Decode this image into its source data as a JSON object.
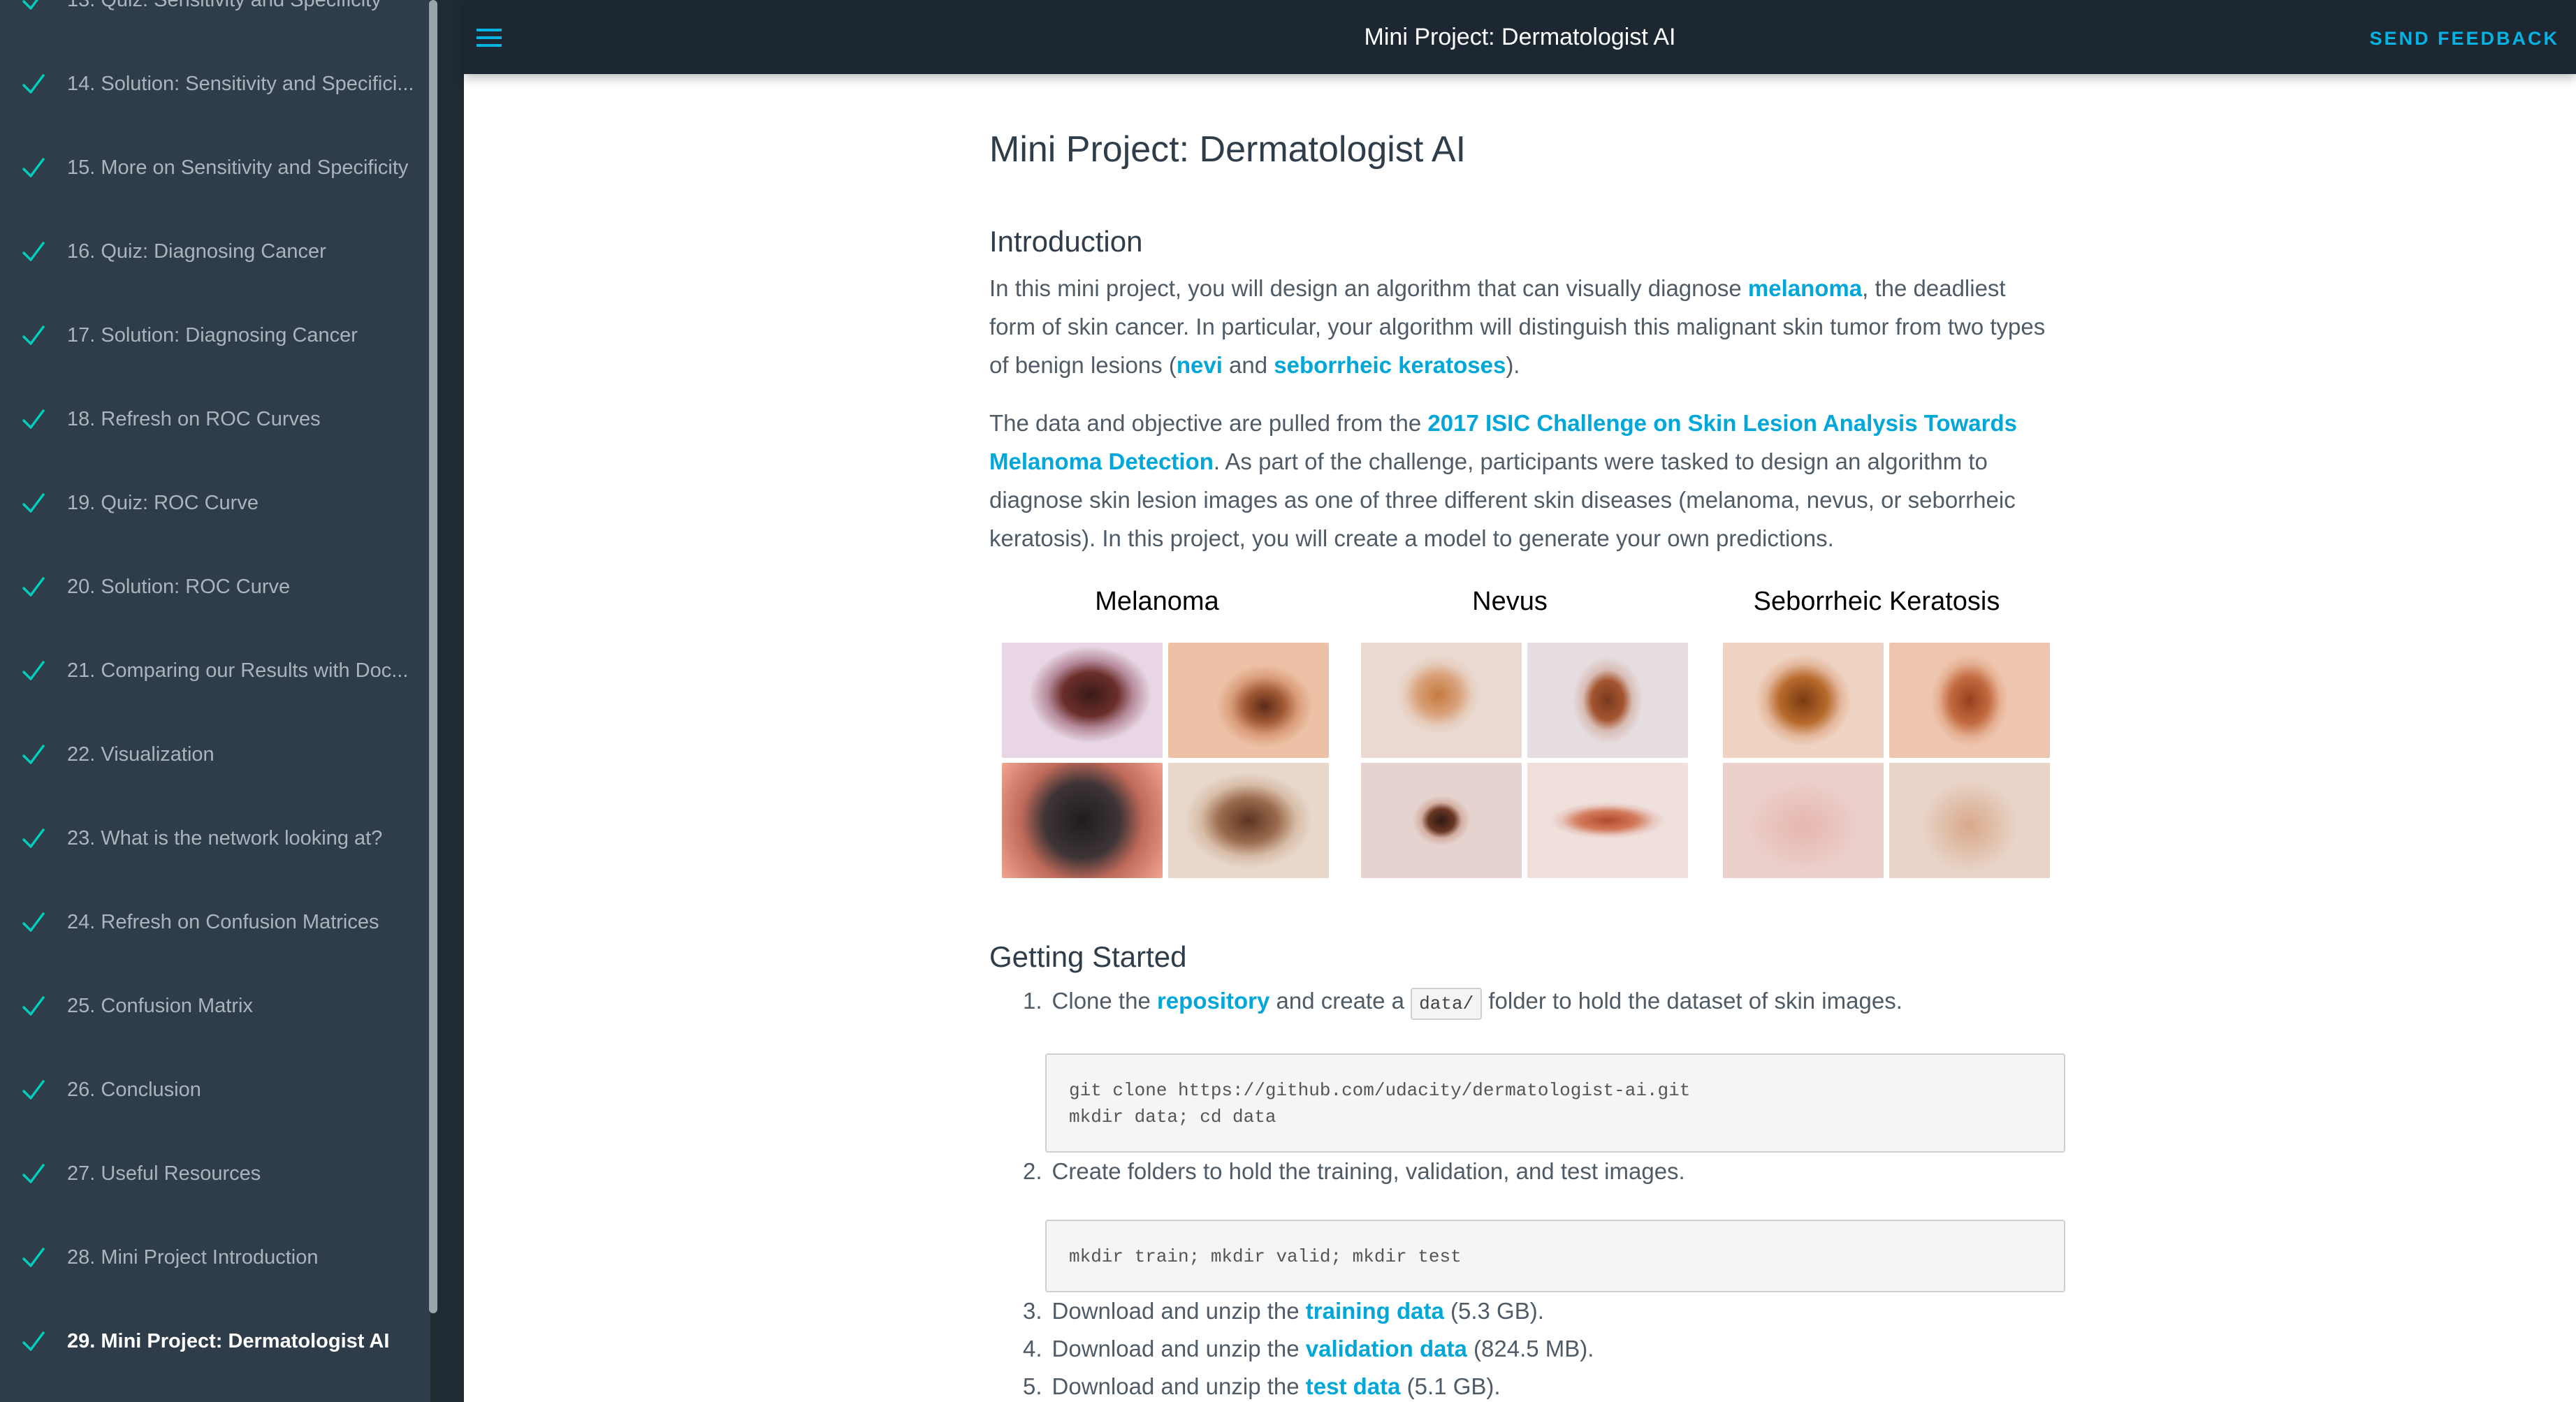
{
  "sidebar": {
    "items": [
      {
        "label": "13. Quiz: Sensitivity and Specificity",
        "active": false
      },
      {
        "label": "14. Solution: Sensitivity and Specifici...",
        "active": false
      },
      {
        "label": "15. More on Sensitivity and Specificity",
        "active": false
      },
      {
        "label": "16. Quiz: Diagnosing Cancer",
        "active": false
      },
      {
        "label": "17. Solution: Diagnosing Cancer",
        "active": false
      },
      {
        "label": "18. Refresh on ROC Curves",
        "active": false
      },
      {
        "label": "19. Quiz: ROC Curve",
        "active": false
      },
      {
        "label": "20. Solution: ROC Curve",
        "active": false
      },
      {
        "label": "21. Comparing our Results with Doc...",
        "active": false
      },
      {
        "label": "22. Visualization",
        "active": false
      },
      {
        "label": "23. What is the network looking at?",
        "active": false
      },
      {
        "label": "24. Refresh on Confusion Matrices",
        "active": false
      },
      {
        "label": "25. Confusion Matrix",
        "active": false
      },
      {
        "label": "26. Conclusion",
        "active": false
      },
      {
        "label": "27. Useful Resources",
        "active": false
      },
      {
        "label": "28. Mini Project Introduction",
        "active": false
      },
      {
        "label": "29. Mini Project: Dermatologist AI",
        "active": true
      }
    ],
    "check_icon": "checkmark-icon",
    "check_color": "#02ccba"
  },
  "topbar": {
    "title": "Mini Project: Dermatologist AI",
    "feedback_label": "SEND FEEDBACK",
    "menu_icon": "hamburger-menu-icon"
  },
  "colors": {
    "accent": "#02b3e4",
    "link": "#02a7d9",
    "sidebar_bg": "#2e3d49",
    "topbar_bg": "#1c2731"
  },
  "main": {
    "title": "Mini Project: Dermatologist AI",
    "intro_heading": "Introduction",
    "intro_p1": {
      "t1": "In this mini project, you will design an algorithm that can visually diagnose ",
      "link1": "melanoma",
      "t2": ", the deadliest form of skin cancer. In particular, your algorithm will distinguish this malignant skin tumor from two types of benign lesions (",
      "link2": "nevi",
      "t3": " and ",
      "link3": "seborrheic keratoses",
      "t4": ")."
    },
    "intro_p2": {
      "t1": "The data and objective are pulled from the ",
      "link1": "2017 ISIC Challenge on Skin Lesion Analysis Towards Melanoma Detection",
      "t2": ". As part of the challenge, participants were tasked to design an algorithm to diagnose skin lesion images as one of three different skin diseases (melanoma, nevus, or seborrheic keratosis). In this project, you will create a model to generate your own predictions."
    },
    "figure": {
      "headings": [
        "Melanoma",
        "Nevus",
        "Seborrheic Keratosis"
      ]
    },
    "getting_started_heading": "Getting Started",
    "steps": [
      {
        "num": "1.",
        "t1": "Clone the ",
        "link": "repository",
        "t2": " and create a ",
        "code": "data/",
        "t3": " folder to hold the dataset of skin images."
      },
      {
        "num": "2.",
        "t1": "Create folders to hold the training, validation, and test images."
      },
      {
        "num": "3.",
        "t1": "Download and unzip the ",
        "link": "training data",
        "t2": " (5.3 GB)."
      },
      {
        "num": "4.",
        "t1": "Download and unzip the ",
        "link": "validation data",
        "t2": " (824.5 MB)."
      },
      {
        "num": "5.",
        "t1": "Download and unzip the ",
        "link": "test data",
        "t2": " (5.1 GB)."
      }
    ],
    "code1": "git clone https://github.com/udacity/dermatologist-ai.git\nmkdir data; cd data",
    "code2": "mkdir train; mkdir valid; mkdir test"
  }
}
